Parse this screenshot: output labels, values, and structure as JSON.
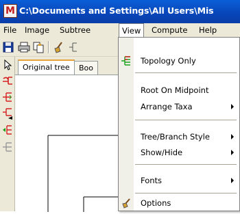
{
  "window": {
    "title": "C:\\Documents and Settings\\All Users\\Mis",
    "icon_label": "M"
  },
  "menubar": {
    "items": [
      {
        "label": "File"
      },
      {
        "label": "Image"
      },
      {
        "label": "Subtree"
      },
      {
        "label": "View"
      },
      {
        "label": "Compute"
      },
      {
        "label": "Help"
      }
    ],
    "active": "View"
  },
  "toolbar": {
    "icons": [
      "save-icon",
      "print-icon",
      "copy-icon",
      "broom-icon",
      "tree-icon"
    ]
  },
  "tabs": [
    {
      "label": "Original tree"
    },
    {
      "label": "Boo"
    }
  ],
  "view_menu": {
    "items": [
      {
        "label": "Topology Only",
        "icon": "topology-icon"
      },
      {
        "label": "Root On Midpoint"
      },
      {
        "label": "Arrange Taxa",
        "submenu": true
      },
      {
        "label": "Tree/Branch Style",
        "submenu": true
      },
      {
        "label": "Show/Hide",
        "submenu": true
      },
      {
        "label": "Fonts",
        "submenu": true
      },
      {
        "label": "Options",
        "icon": "options-icon"
      }
    ]
  },
  "colors": {
    "titlebar": "#0a4fcf",
    "menubar": "#ece9d8",
    "tab_accent": "#e8a23a"
  }
}
